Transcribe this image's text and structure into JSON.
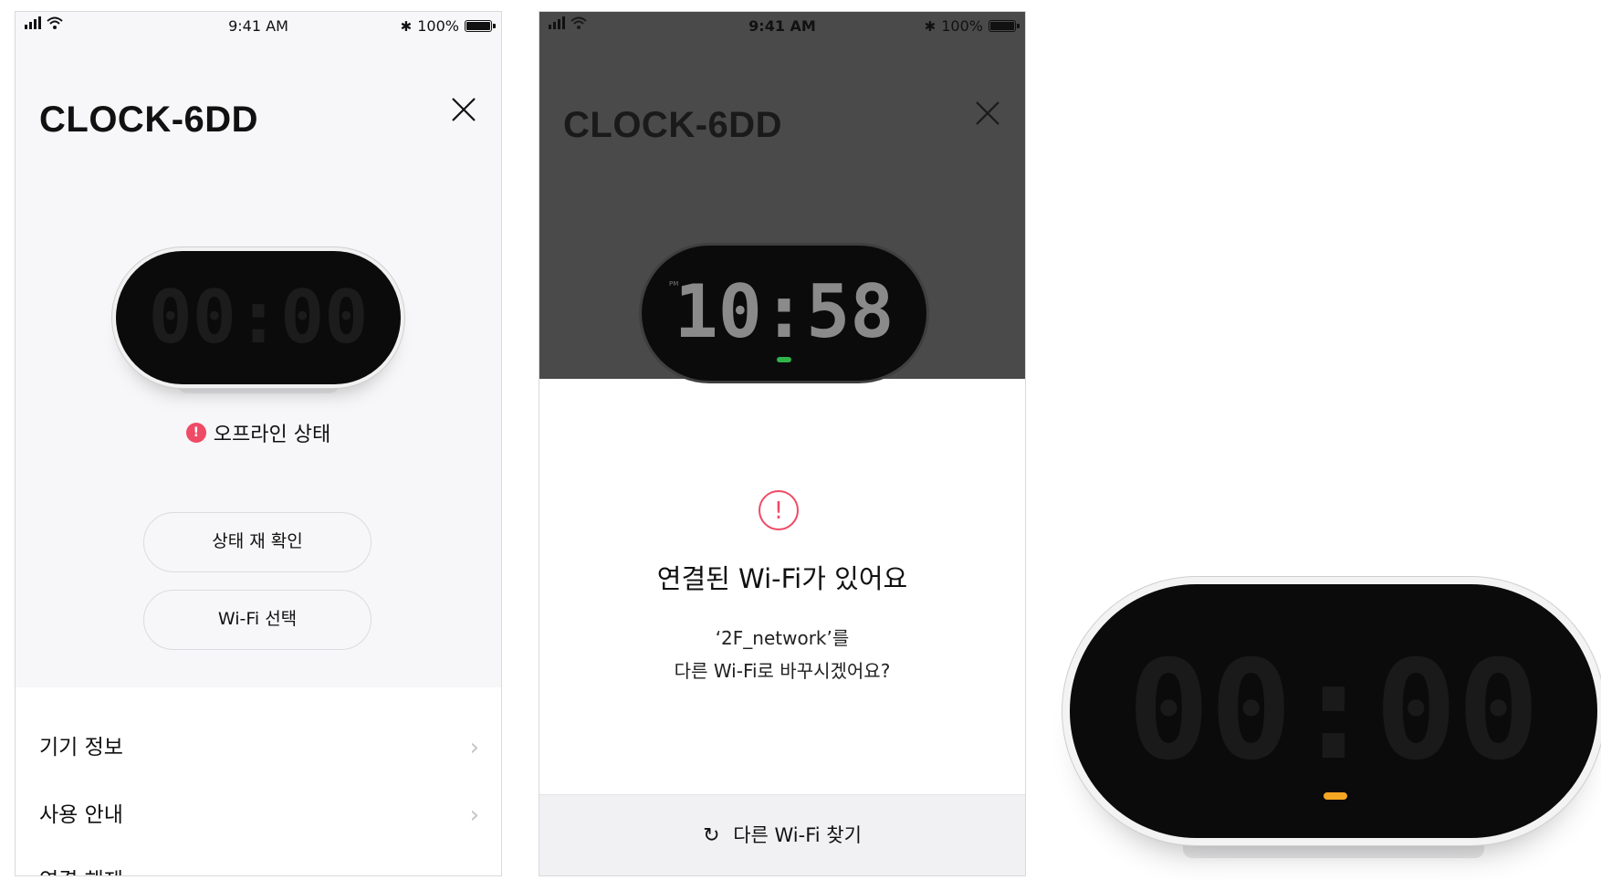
{
  "screen1": {
    "status_bar": {
      "time": "9:41 AM",
      "battery": "100%"
    },
    "device_name": "CLOCK-6DD",
    "clock_display": "00:00",
    "status_text": "오프라인 상태",
    "buttons": {
      "recheck": "상태 재 확인",
      "wifi_select": "Wi-Fi 선택"
    },
    "menu": [
      {
        "label": "기기 정보"
      },
      {
        "label": "사용 안내"
      },
      {
        "label": "연결 해제"
      }
    ]
  },
  "screen2": {
    "status_bar": {
      "time": "9:41 AM",
      "battery": "100%"
    },
    "device_name": "CLOCK-6DD",
    "clock_display": "10:58",
    "clock_pm": "PM",
    "dialog": {
      "title": "연결된 Wi-Fi가 있어요",
      "line1": "‘2F_network’를",
      "line2": "다른 Wi-Fi로 바꾸시겠어요?"
    },
    "action": "다른 Wi-Fi 찾기"
  },
  "product": {
    "clock_display": "00:00"
  },
  "colors": {
    "alert": "#ef4a66",
    "indicator_green": "#2fb34a",
    "indicator_orange": "#f5a623"
  }
}
